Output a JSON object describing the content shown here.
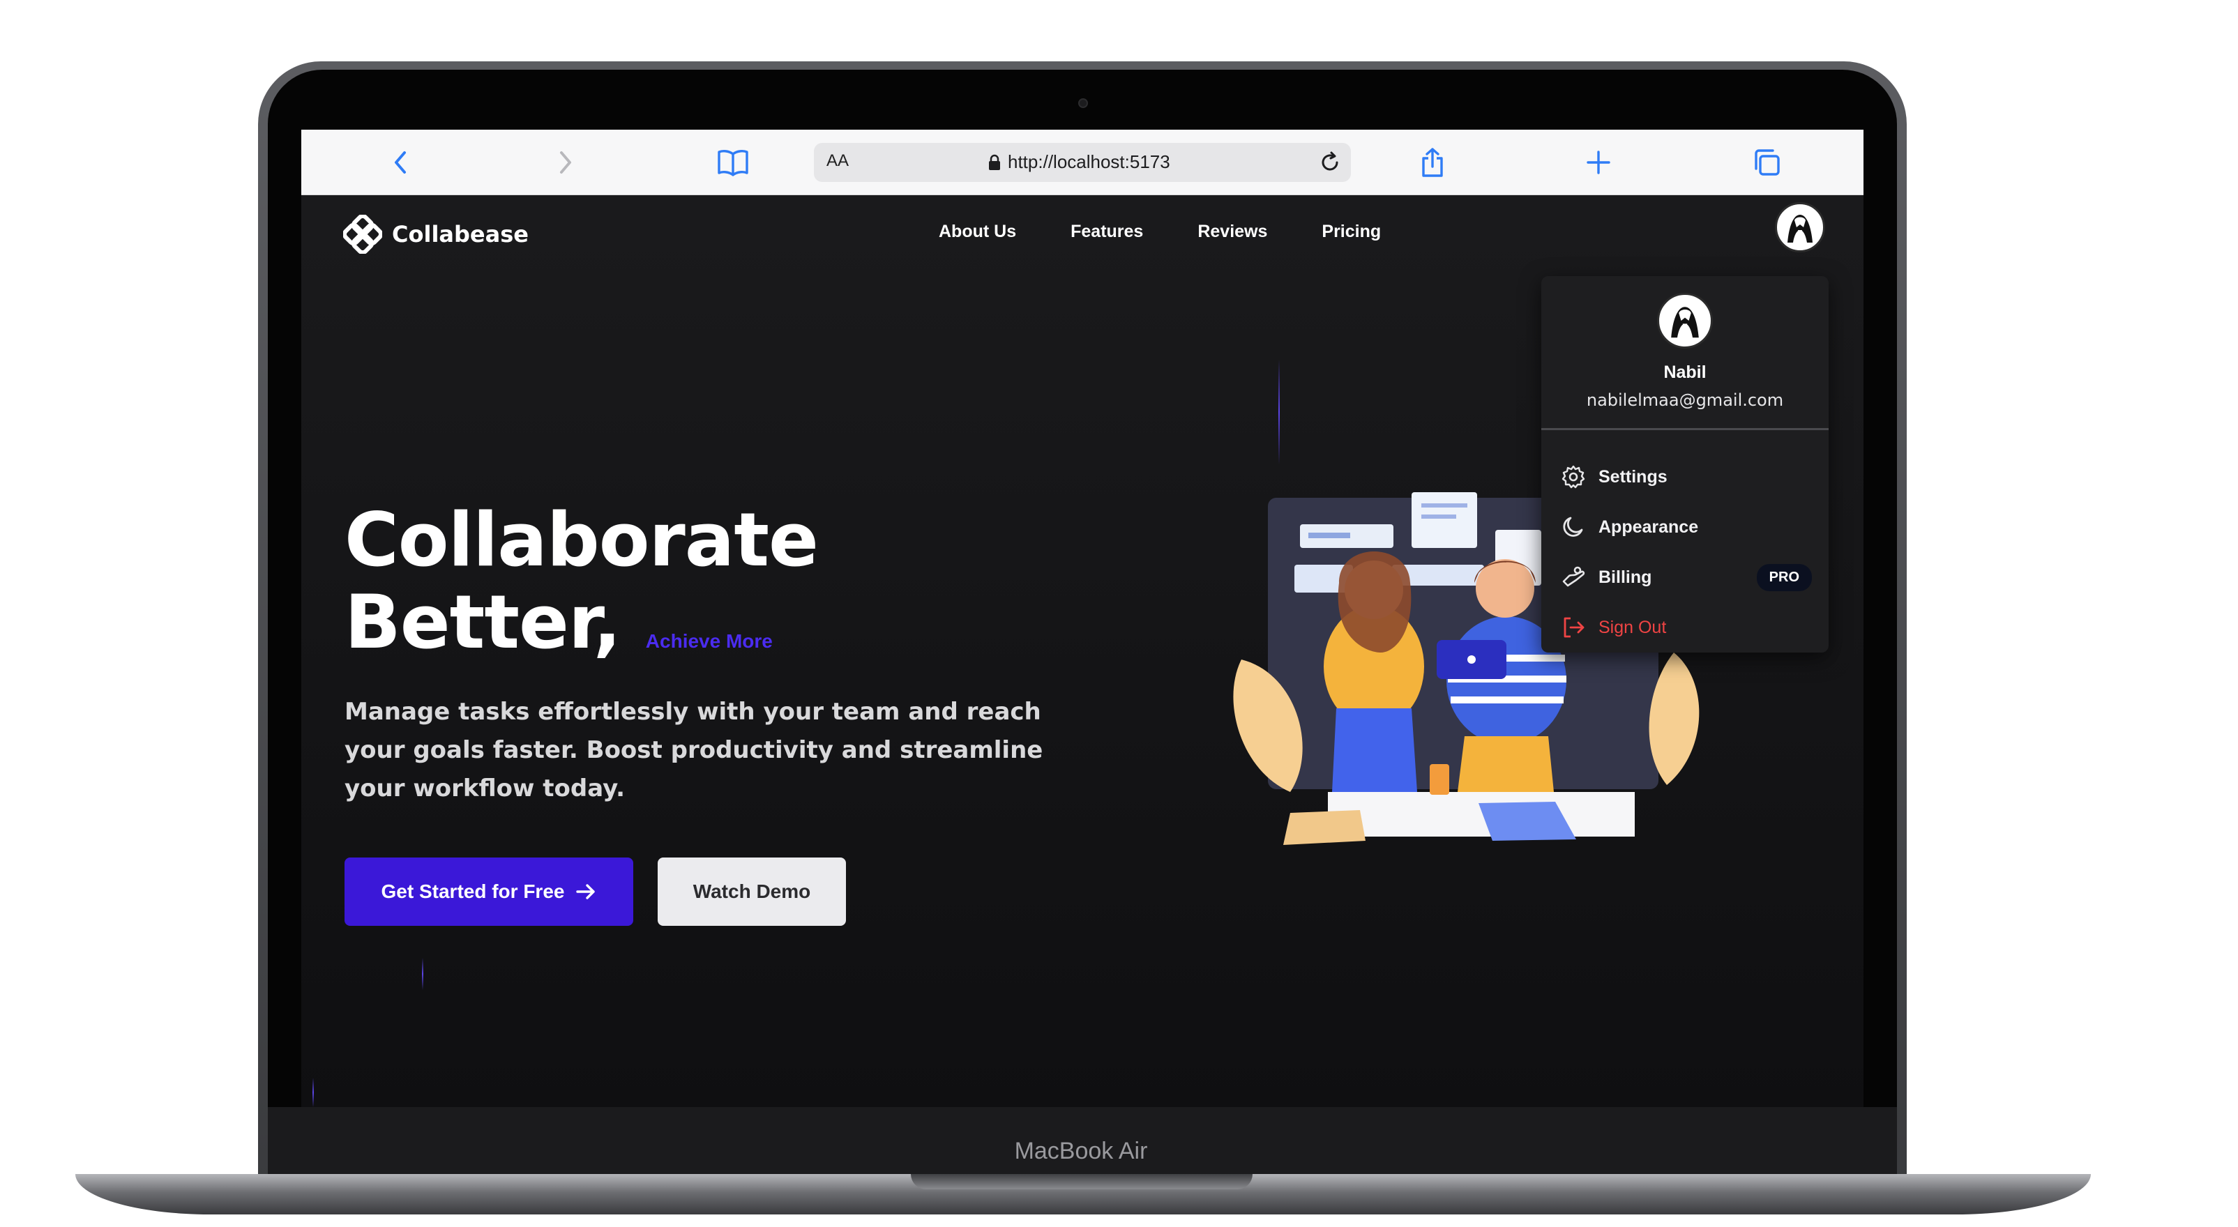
{
  "device": {
    "label": "MacBook Air"
  },
  "browser": {
    "url": "http://localhost:5173",
    "text_size_label": "AA",
    "icons": [
      "back-icon",
      "forward-icon",
      "reader-icon",
      "lock-icon",
      "reload-icon",
      "share-icon",
      "new-tab-icon",
      "tabs-icon"
    ]
  },
  "nav": {
    "logo_text": "Collabease",
    "links": [
      "About Us",
      "Features",
      "Reviews",
      "Pricing"
    ]
  },
  "hero": {
    "title_line1": "Collaborate",
    "title_line2": "Better,",
    "title_accent": "Achieve More",
    "description": "Manage tasks effortlessly with your team and reach your goals faster. Boost productivity and streamline your workflow today.",
    "primary_cta": "Get Started for Free",
    "secondary_cta": "Watch Demo"
  },
  "user_menu": {
    "name": "Nabil",
    "email": "nabilelmaa@gmail.com",
    "items": [
      {
        "label": "Settings",
        "icon": "gear-icon"
      },
      {
        "label": "Appearance",
        "icon": "moon-icon"
      },
      {
        "label": "Billing",
        "icon": "billing-icon",
        "badge": "PRO"
      },
      {
        "label": "Sign Out",
        "icon": "sign-out-icon"
      }
    ]
  },
  "colors": {
    "accent": "#3b18d8",
    "accent_text": "#4b2cf0",
    "danger": "#ef4444",
    "background": "#151517"
  }
}
